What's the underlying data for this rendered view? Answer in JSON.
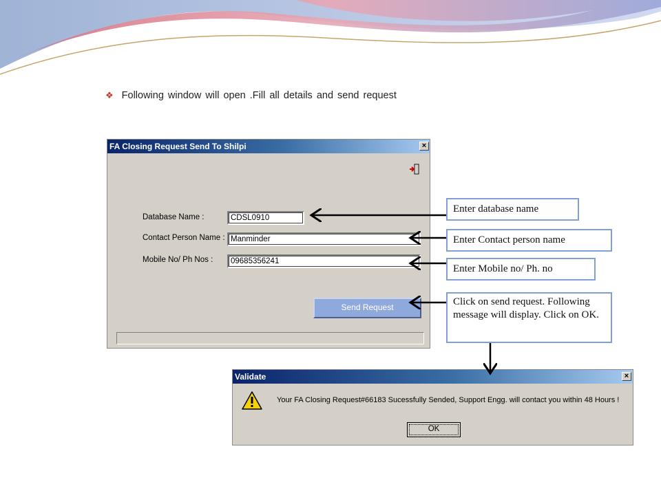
{
  "instruction": {
    "text": "Following window will open .Fill all details and send request"
  },
  "main_dialog": {
    "title": "FA Closing Request Send To Shilpi",
    "close_glyph": "×",
    "database_label": "Database Name :",
    "database_value": "CDSL0910",
    "contact_label": "Contact Person Name :",
    "contact_value": "Manminder",
    "mobile_label": "Mobile No/ Ph Nos :",
    "mobile_value": "09685356241",
    "send_button": "Send Request"
  },
  "callouts": {
    "database": "Enter database name",
    "contact": "Enter  Contact person name",
    "mobile": "Enter Mobile no/ Ph. no",
    "send": "Click on send request. Following message will display. Click on OK."
  },
  "validate_dialog": {
    "title": "Validate",
    "close_glyph": "×",
    "message": "Your FA Closing Request#66183 Sucessfully Sended, Support Engg. will contact you within 48 Hours !",
    "ok_button": "OK"
  },
  "colors": {
    "callout_border": "#7f9fd6",
    "titlebar_start": "#0a246a",
    "titlebar_end": "#a6caf0",
    "send_button": "#8fa9dc",
    "warning_yellow": "#f5d20a"
  },
  "icons": {
    "bullet": "diamond-bullet-icon",
    "exit": "exit-door-icon",
    "warning": "warning-icon"
  }
}
